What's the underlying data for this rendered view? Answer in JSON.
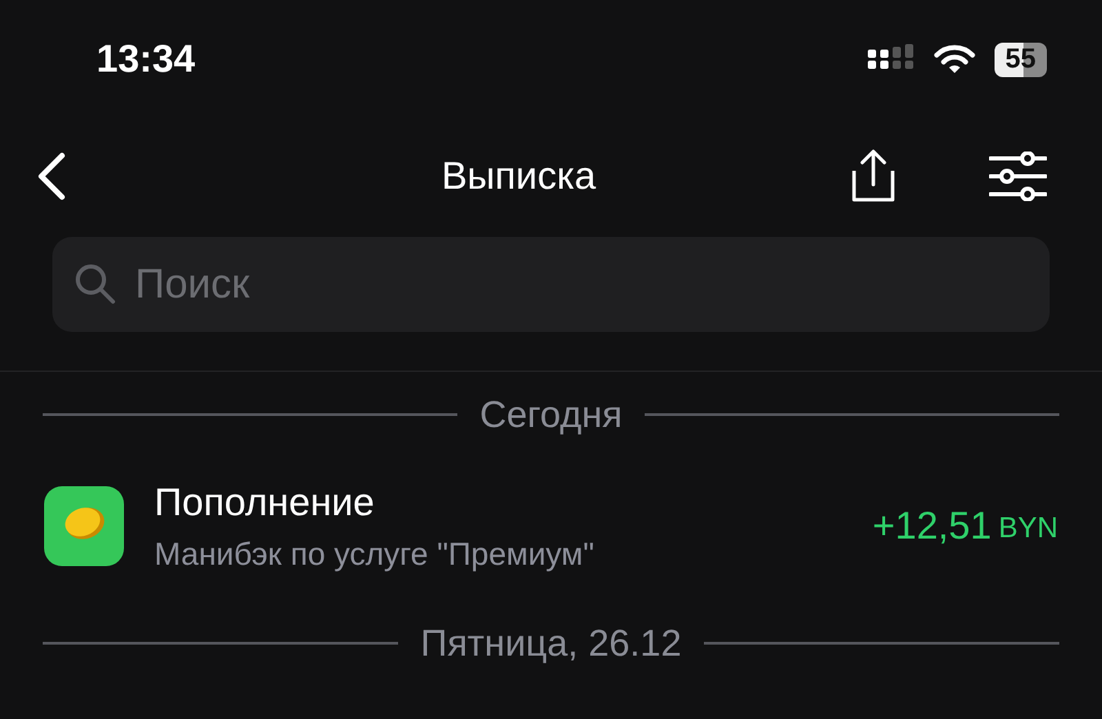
{
  "status_bar": {
    "time": "13:34",
    "battery": "55"
  },
  "nav": {
    "title": "Выписка"
  },
  "search": {
    "placeholder": "Поиск"
  },
  "sections": [
    {
      "header": "Сегодня",
      "transactions": [
        {
          "title": "Пополнение",
          "subtitle": "Манибэк по услуге \"Премиум\"",
          "amount": "+12,51",
          "currency": "BYN",
          "kind": "income"
        }
      ]
    },
    {
      "header": "Пятница, 26.12"
    }
  ]
}
